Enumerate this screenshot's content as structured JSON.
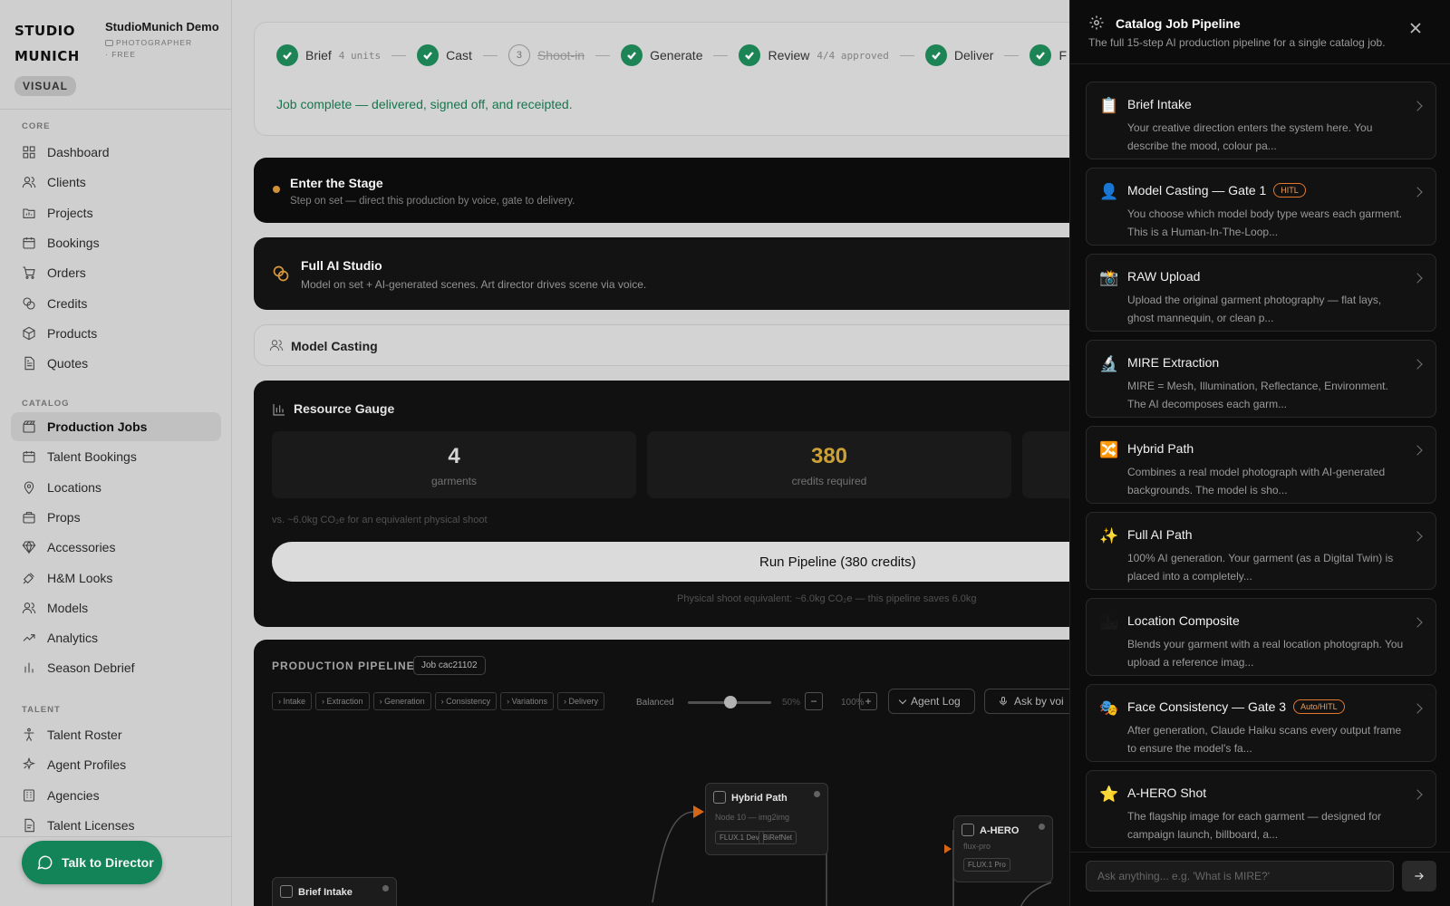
{
  "sidebar": {
    "brand_line1": "STUDIO",
    "brand_line2": "MUNICH",
    "org_name": "StudioMunich Demo",
    "org_plan": "PHOTOGRAPHER · FREE",
    "visual_badge": "VISUAL",
    "sections": {
      "core": "CORE",
      "catalog": "CATALOG",
      "talent": "TALENT"
    },
    "core_items": [
      {
        "label": "Dashboard",
        "icon": "grid-icon"
      },
      {
        "label": "Clients",
        "icon": "users-icon"
      },
      {
        "label": "Projects",
        "icon": "folder-icon"
      },
      {
        "label": "Bookings",
        "icon": "calendar-icon"
      },
      {
        "label": "Orders",
        "icon": "cart-icon"
      },
      {
        "label": "Credits",
        "icon": "coins-icon"
      },
      {
        "label": "Products",
        "icon": "box-icon"
      },
      {
        "label": "Quotes",
        "icon": "document-icon"
      }
    ],
    "catalog_items": [
      {
        "label": "Production Jobs",
        "icon": "clapperboard-icon",
        "active": true
      },
      {
        "label": "Talent Bookings",
        "icon": "calendar-icon"
      },
      {
        "label": "Locations",
        "icon": "map-pin-icon"
      },
      {
        "label": "Props",
        "icon": "package-icon"
      },
      {
        "label": "Accessories",
        "icon": "gem-icon"
      },
      {
        "label": "H&M Looks",
        "icon": "shirt-icon"
      },
      {
        "label": "Models",
        "icon": "users-icon"
      },
      {
        "label": "Analytics",
        "icon": "trend-icon"
      },
      {
        "label": "Season Debrief",
        "icon": "bar-chart-icon"
      }
    ],
    "talent_items": [
      {
        "label": "Talent Roster",
        "icon": "person-icon"
      },
      {
        "label": "Agent Profiles",
        "icon": "sparkle-icon"
      },
      {
        "label": "Agencies",
        "icon": "building-icon"
      },
      {
        "label": "Talent Licenses",
        "icon": "license-icon"
      }
    ],
    "talk_button": "Talk to Director"
  },
  "stepper": {
    "steps": [
      {
        "label": "Brief",
        "sub": "4 units",
        "done": true
      },
      {
        "label": "Cast",
        "sub": "",
        "done": true
      },
      {
        "label": "Shoot-in",
        "sub": "",
        "done": false,
        "number": "3",
        "skipped": true
      },
      {
        "label": "Generate",
        "sub": "",
        "done": true
      },
      {
        "label": "Review",
        "sub": "4/4 approved",
        "done": true
      },
      {
        "label": "Deliver",
        "sub": "",
        "done": true
      },
      {
        "label": "F",
        "sub": "",
        "done": true
      }
    ],
    "status": "Job complete — delivered, signed off, and receipted."
  },
  "stage": {
    "title": "Enter the Stage",
    "subtitle": "Step on set — direct this production by voice, gate to delivery."
  },
  "ai_studio": {
    "title": "Full AI Studio",
    "subtitle": "Model on set + AI-generated scenes. Art director drives scene via voice."
  },
  "model_casting": {
    "title": "Model Casting"
  },
  "gauge": {
    "title": "Resource Gauge",
    "stats": [
      {
        "value": "4",
        "label": "garments"
      },
      {
        "value": "380",
        "label": "credits required"
      }
    ],
    "co2_note": "vs. ~6.0kg CO₂e for an equivalent physical shoot",
    "run_button": "Run Pipeline (380 credits)",
    "run_note": "Physical shoot equivalent: ~6.0kg CO₂e — this pipeline saves 6.0kg"
  },
  "pipeline": {
    "title": "PRODUCTION PIPELINE",
    "job_tag": "Job cac21102",
    "filters": [
      "Intake",
      "Extraction",
      "Generation",
      "Consistency",
      "Variations",
      "Delivery"
    ],
    "balanced_label": "Balanced",
    "slider_value": 0.5,
    "slider_pct": "50%",
    "zoom_minus": "−",
    "zoom_pct": "100%",
    "zoom_plus": "+",
    "agent_log": "Agent Log",
    "ask_by_voice": "Ask by voi",
    "nodes": [
      {
        "title": "Hybrid Path",
        "sub": "Node 10 — img2img",
        "tags": [
          "FLUX.1 Dev",
          "BiRefNet"
        ]
      },
      {
        "title": "A-HERO",
        "sub": "flux-pro",
        "tags": [
          "FLUX.1 Pro"
        ]
      },
      {
        "title": "Brief Intake",
        "sub": "",
        "tags": []
      }
    ]
  },
  "panel": {
    "title": "Catalog Job Pipeline",
    "subtitle": "The full 15-step AI production pipeline for a single catalog job.",
    "items": [
      {
        "icon": "📋",
        "title": "Brief Intake",
        "badge": "",
        "desc": "Your creative direction enters the system here. You describe the mood, colour pa..."
      },
      {
        "icon": "👤",
        "title": "Model Casting — Gate 1",
        "badge": "HITL",
        "desc": "You choose which model body type wears each garment. This is a Human-In-The-Loop..."
      },
      {
        "icon": "📸",
        "title": "RAW Upload",
        "badge": "",
        "desc": "Upload the original garment photography — flat lays, ghost mannequin, or clean p..."
      },
      {
        "icon": "🔬",
        "title": "MIRE Extraction",
        "badge": "",
        "desc": "MIRE = Mesh, Illumination, Reflectance, Environment. The AI decomposes each garm..."
      },
      {
        "icon": "🔀",
        "title": "Hybrid Path",
        "badge": "",
        "desc": "Combines a real model photograph with AI-generated backgrounds. The model is sho..."
      },
      {
        "icon": "✨",
        "title": "Full AI Path",
        "badge": "",
        "desc": "100% AI generation. Your garment (as a Digital Twin) is placed into a completely..."
      },
      {
        "icon": "🏙",
        "title": "Location Composite",
        "badge": "",
        "desc": "Blends your garment with a real location photograph. You upload a reference imag..."
      },
      {
        "icon": "🎭",
        "title": "Face Consistency — Gate 3",
        "badge": "Auto/HITL",
        "desc": "After generation, Claude Haiku scans every output frame to ensure the model's fa..."
      },
      {
        "icon": "⭐",
        "title": "A-HERO Shot",
        "badge": "",
        "desc": "The flagship image for each garment — designed for campaign launch, billboard, a..."
      }
    ],
    "ask_placeholder": "Ask anything... e.g. 'What is MIRE?'"
  },
  "colors": {
    "accent_green": "#138a5c",
    "check_green": "#1f8a5a",
    "credit_gold": "#d4a83a",
    "badge_orange": "#e2782c",
    "node_arrow": "#e06a1a"
  }
}
